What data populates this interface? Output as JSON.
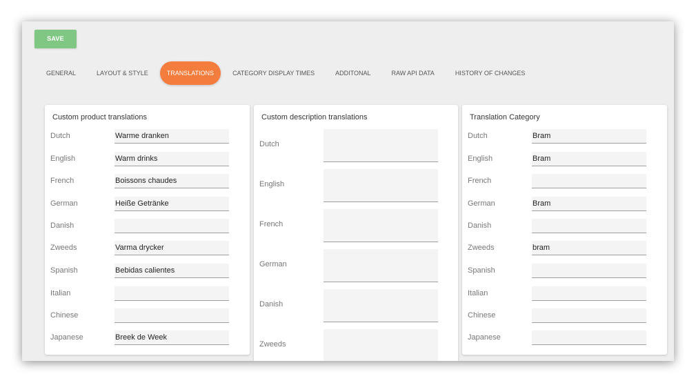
{
  "toolbar": {
    "save_label": "SAVE"
  },
  "tabs": [
    {
      "label": "GENERAL",
      "active": false
    },
    {
      "label": "LAYOUT & STYLE",
      "active": false
    },
    {
      "label": "TRANSLATIONS",
      "active": true
    },
    {
      "label": "CATEGORY DISPLAY TIMES",
      "active": false
    },
    {
      "label": "ADDITONAL",
      "active": false
    },
    {
      "label": "RAW API DATA",
      "active": false
    },
    {
      "label": "HISTORY OF CHANGES",
      "active": false
    }
  ],
  "product_translations": {
    "title": "Custom product translations",
    "rows": [
      {
        "label": "Dutch",
        "value": "Warme dranken"
      },
      {
        "label": "English",
        "value": "Warm drinks"
      },
      {
        "label": "French",
        "value": "Boissons chaudes"
      },
      {
        "label": "German",
        "value": "Heiße Getränke"
      },
      {
        "label": "Danish",
        "value": ""
      },
      {
        "label": "Zweeds",
        "value": "Varma drycker"
      },
      {
        "label": "Spanish",
        "value": "Bebidas calientes"
      },
      {
        "label": "Italian",
        "value": ""
      },
      {
        "label": "Chinese",
        "value": ""
      },
      {
        "label": "Japanese",
        "value": "Breek de Week"
      }
    ]
  },
  "description_translations": {
    "title": "Custom description translations",
    "rows": [
      {
        "label": "Dutch",
        "value": ""
      },
      {
        "label": "English",
        "value": ""
      },
      {
        "label": "French",
        "value": ""
      },
      {
        "label": "German",
        "value": ""
      },
      {
        "label": "Danish",
        "value": ""
      },
      {
        "label": "Zweeds",
        "value": ""
      }
    ]
  },
  "category_translations": {
    "title": "Translation Category",
    "rows": [
      {
        "label": "Dutch",
        "value": "Bram"
      },
      {
        "label": "English",
        "value": "Bram"
      },
      {
        "label": "French",
        "value": ""
      },
      {
        "label": "German",
        "value": "Bram"
      },
      {
        "label": "Danish",
        "value": ""
      },
      {
        "label": "Zweeds",
        "value": "bram"
      },
      {
        "label": "Spanish",
        "value": ""
      },
      {
        "label": "Italian",
        "value": ""
      },
      {
        "label": "Chinese",
        "value": ""
      },
      {
        "label": "Japanese",
        "value": ""
      }
    ]
  },
  "colors": {
    "save_button": "#81c784",
    "active_tab": "#f47c3c",
    "background": "#eeeeee"
  }
}
